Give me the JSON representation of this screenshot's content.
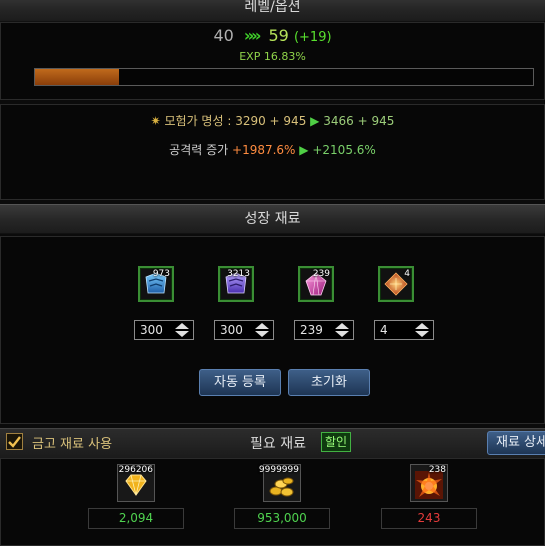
{
  "level_section": {
    "header": "레벨/옵션",
    "current_level": "40",
    "arrow": "»»",
    "next_level": "59",
    "level_gain": "(+19)",
    "exp_text": "EXP 16.83%",
    "exp_progress": 0.168
  },
  "option_section": {
    "fame_label": "모험가 명성 :",
    "fame_before": "3290 + 945",
    "fame_after": "3466 + 945",
    "attack_label": "공격력 증가",
    "attack_before": "+1987.6%",
    "attack_after": "+2105.6%"
  },
  "growth_section": {
    "header": "성장 재료",
    "slots": [
      {
        "count": "973",
        "quantity": "300",
        "icon": "blue-material-icon",
        "color": "#2f7fcf"
      },
      {
        "count": "3213",
        "quantity": "300",
        "icon": "purple-material-icon",
        "color": "#6a4fd6"
      },
      {
        "count": "239",
        "quantity": "239",
        "icon": "pink-crystal-icon",
        "color": "#d63ea8"
      },
      {
        "count": "4",
        "quantity": "4",
        "icon": "orange-crystal-icon",
        "color": "#d8531a"
      }
    ],
    "auto_register_label": "자동 등록",
    "reset_label": "초기화"
  },
  "required_section": {
    "use_vault_label": "금고 재료 사용",
    "use_vault_checked": true,
    "title": "필요 재료",
    "discount_badge": "할인",
    "material_detail_label": "재료 상세",
    "materials": [
      {
        "count": "296206",
        "cost": "2,094",
        "cost_color": "#4fd24f",
        "icon": "gold-gem-icon"
      },
      {
        "count": "9999999",
        "cost": "953,000",
        "cost_color": "#4fd24f",
        "icon": "gold-coins-icon"
      },
      {
        "count": "238",
        "cost": "243",
        "cost_color": "#e53b3b",
        "icon": "energy-burst-icon"
      }
    ]
  }
}
